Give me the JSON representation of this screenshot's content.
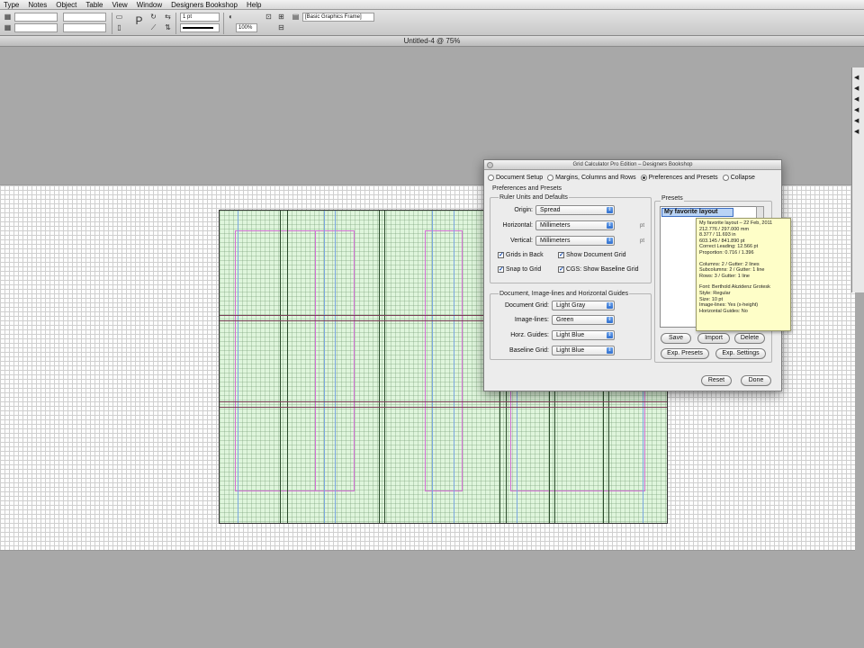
{
  "menubar": {
    "items": [
      "Type",
      "Notes",
      "Object",
      "Table",
      "View",
      "Window",
      "Designers Bookshop",
      "Help"
    ]
  },
  "controlbar": {
    "stroke_weight": "1 pt",
    "zoom_percent": "100%",
    "object_style": "[Basic Graphics Frame]"
  },
  "document": {
    "title": "Untitled-4 @ 75%"
  },
  "dialog": {
    "title": "Grid Calculator Pro Edition – Designers Bookshop",
    "tabs": [
      {
        "label": "Document Setup",
        "selected": false
      },
      {
        "label": "Margins, Columns and Rows",
        "selected": false
      },
      {
        "label": "Preferences and Presets",
        "selected": true
      },
      {
        "label": "Collapse",
        "selected": false
      }
    ],
    "prefs_group_title": "Preferences and Presets",
    "ruler": {
      "title": "Ruler Units and Defaults",
      "origin_label": "Origin:",
      "origin_value": "Spread",
      "horizontal_label": "Horizontal:",
      "horizontal_value": "Millimeters",
      "horizontal_unit": "pt",
      "vertical_label": "Vertical:",
      "vertical_value": "Millimeters",
      "vertical_unit": "pt",
      "grids_in_back": "Grids in Back",
      "show_document_grid": "Show Document Grid",
      "snap_to_grid": "Snap to Grid",
      "cgs_show_baseline": "CGS: Show Baseline Grid"
    },
    "guides": {
      "title": "Document, Image-lines and Horizontal Guides",
      "document_grid_label": "Document Grid:",
      "document_grid_value": "Light Gray",
      "image_lines_label": "Image-lines:",
      "image_lines_value": "Green",
      "horz_guides_label": "Horz. Guides:",
      "horz_guides_value": "Light Blue",
      "baseline_grid_label": "Baseline Grid:",
      "baseline_grid_value": "Light Blue"
    },
    "presets": {
      "title": "Presets",
      "selected_item": "My favorite layout",
      "save": "Save",
      "import": "Import",
      "delete": "Delete",
      "exp_presets": "Exp. Presets",
      "exp_settings": "Exp. Settings"
    },
    "reset": "Reset",
    "done": "Done"
  },
  "tooltip": {
    "lines1": [
      "My favorite layout – 22 Feb, 2011",
      "212.776 / 297.000 mm",
      "8.377 / 11.693 in",
      "603.145 / 841.890 pt",
      "Correct Leading: 12.566 pt",
      "Proportion: 0.716 / 1.396"
    ],
    "lines2": [
      "Columns: 2 / Gutter: 2 lines",
      "Subcolumns: 2 / Gutter: 1 line",
      "Rows: 3 / Gutter: 1 line"
    ],
    "lines3": [
      "Font: Berthold Akzidenz Grotesk",
      "Style: Regular",
      "Size: 10 pt",
      "Image-lines: Yes (x-height)",
      "Horizontal Guides: No"
    ]
  },
  "colors": {
    "page_fill": "#dff5dc",
    "image_lines": "#2c4c2c",
    "row_guides": "#7a3d56",
    "margin_boxes": "#d46fd4",
    "baseline": "#7aa6e0"
  }
}
